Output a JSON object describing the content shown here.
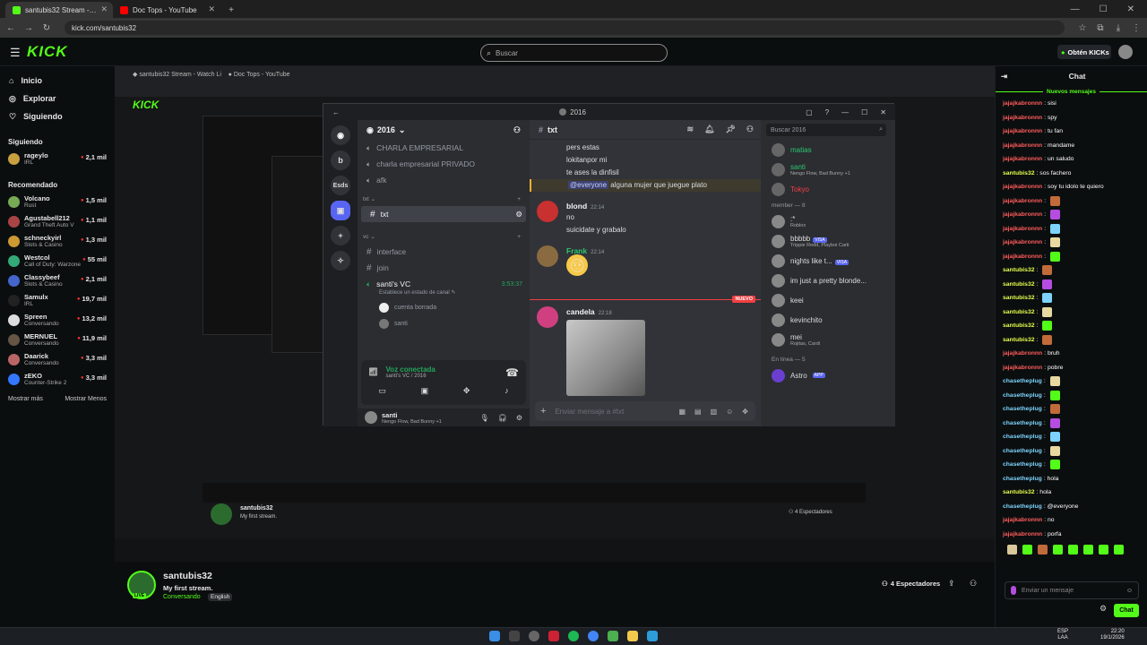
{
  "browser": {
    "tabs": [
      {
        "title": "santubis32 Stream - Watch Live",
        "active": true
      },
      {
        "title": "Doc Tops - YouTube",
        "active": false
      }
    ],
    "url": "kick.com/santubis32"
  },
  "kick": {
    "logo": "KICK",
    "search_placeholder": "Buscar",
    "get_kicks": "Obtén KICKs",
    "nav": [
      {
        "label": "Inicio",
        "icon": "home-icon"
      },
      {
        "label": "Explorar",
        "icon": "compass-icon"
      },
      {
        "label": "Siguiendo",
        "icon": "heart-icon"
      }
    ],
    "following_header": "Siguiendo",
    "following": [
      {
        "name": "rageylo",
        "game": "IRL",
        "viewers": "2,1 mil"
      }
    ],
    "recommended_header": "Recomendado",
    "recommended": [
      {
        "name": "Volcano",
        "game": "Rust",
        "viewers": "1,5 mil"
      },
      {
        "name": "Agustabell212",
        "game": "Grand Theft Auto V",
        "viewers": "1,1 mil"
      },
      {
        "name": "schneckyirl",
        "game": "Slots & Casino",
        "viewers": "1,3 mil"
      },
      {
        "name": "Westcol",
        "game": "Call of Duty: Warzone",
        "viewers": "55 mil"
      },
      {
        "name": "Classybeef",
        "game": "Slots & Casino",
        "viewers": "2,1 mil"
      },
      {
        "name": "Samulx",
        "game": "IRL",
        "viewers": "19,7 mil"
      },
      {
        "name": "Spreen",
        "game": "Conversando",
        "viewers": "13,2 mil"
      },
      {
        "name": "MERNUEL",
        "game": "Conversando",
        "viewers": "11,9 mil"
      },
      {
        "name": "Daarick",
        "game": "Conversando",
        "viewers": "3,3 mil"
      },
      {
        "name": "zEKO",
        "game": "Counter-Strike 2",
        "viewers": "3,3 mil"
      }
    ],
    "show_more": "Mostrar más",
    "show_less": "Mostrar Menos"
  },
  "discord": {
    "window_title": "2016",
    "server_name": "2016",
    "server_icons": [
      "b",
      "Esds"
    ],
    "channels_top": [
      {
        "name": "CHARLA EMPRESARIAL",
        "type": "voice"
      },
      {
        "name": "charla empresarial PRIVADO",
        "type": "voice"
      },
      {
        "name": "afk",
        "type": "voice"
      }
    ],
    "cat_txt": "txt",
    "txt_channel": "txt",
    "cat_vc": "vc",
    "vc_channels": [
      {
        "name": "interface",
        "type": "text"
      },
      {
        "name": "join",
        "type": "text"
      }
    ],
    "active_vc": {
      "name": "santi's VC",
      "time": "3:53:37",
      "status": "Establece un estado de canal"
    },
    "vc_users": [
      "cuenta borrada",
      "santi"
    ],
    "voice_connected": "Voz conectada",
    "voice_sub": "santi's VC / 2016",
    "user": {
      "name": "santi",
      "status": "Nengo Flow, Bad Bunny +1"
    },
    "channel_header": "txt",
    "search_placeholder": "Buscar 2016",
    "top_messages": [
      "pers estas",
      "lokitanpor mi",
      "te ases la dinfisil"
    ],
    "everyone_msg": {
      "mention": "@everyone",
      "text": "alguna mujer que juegue plato"
    },
    "messages": [
      {
        "author": "blond",
        "time": "22:14",
        "lines": [
          "no",
          "suicidate y grabalo"
        ]
      },
      {
        "author": "Frank",
        "time": "22:14",
        "lines": []
      },
      {
        "author": "candela",
        "time": "22:18",
        "lines": []
      }
    ],
    "new_label": "NUEVO",
    "input_placeholder": "Enviar mensaje a #txt",
    "members_top": [
      {
        "name": "matias",
        "sub": ""
      },
      {
        "name": "santi",
        "sub": "Nengo Flow, Bad Bunny +1"
      },
      {
        "name": "Tokyo",
        "sub": ""
      }
    ],
    "member_cat": "member — 8",
    "members": [
      {
        "name": ":*",
        "sub": "Roblox"
      },
      {
        "name": "bbbbb",
        "sub": "Trippie Redd, Playboi Carti",
        "badge": "VISA"
      },
      {
        "name": "nights like t...",
        "sub": "",
        "badge": "VISA"
      },
      {
        "name": "im just a pretty blonde...",
        "sub": ""
      },
      {
        "name": "keei",
        "sub": ""
      },
      {
        "name": "kevinchito",
        "sub": ""
      },
      {
        "name": "mei",
        "sub": "Rojitas, Cardi"
      }
    ],
    "online_cat": "En línea — 5",
    "online_members": [
      {
        "name": "Astro",
        "badge": "APP"
      }
    ]
  },
  "stream": {
    "streamer": "santubis32",
    "title": "My first stream.",
    "category": "Conversando",
    "language": "English",
    "live_label": "LIVE",
    "viewers": "4 Espectadores"
  },
  "chat": {
    "title": "Chat",
    "new_messages": "Nuevos mensajes",
    "messages": [
      {
        "user": "jajajkabronnn",
        "text": "sisi",
        "color": "#ff5c5c"
      },
      {
        "user": "jajajkabronnn",
        "text": "spy",
        "color": "#ff5c5c"
      },
      {
        "user": "jajajkabronnn",
        "text": "tu fan",
        "color": "#ff5c5c"
      },
      {
        "user": "jajajkabronnn",
        "text": "mandame",
        "color": "#ff5c5c"
      },
      {
        "user": "jajajkabronnn",
        "text": "un saludo",
        "color": "#ff5c5c"
      },
      {
        "user": "santubis32",
        "text": "sos fachero",
        "color": "#e4ff4c"
      },
      {
        "user": "jajajkabronnn",
        "text": "soy tu idolo te quiero",
        "color": "#ff5c5c"
      },
      {
        "user": "jajajkabronnn",
        "text": "",
        "color": "#ff5c5c"
      },
      {
        "user": "jajajkabronnn",
        "text": "",
        "color": "#ff5c5c"
      },
      {
        "user": "jajajkabronnn",
        "text": "",
        "color": "#ff5c5c"
      },
      {
        "user": "jajajkabronnn",
        "text": "",
        "color": "#ff5c5c"
      },
      {
        "user": "jajajkabronnn",
        "text": "",
        "color": "#ff5c5c"
      },
      {
        "user": "santubis32",
        "text": "",
        "color": "#e4ff4c"
      },
      {
        "user": "santubis32",
        "text": "",
        "color": "#e4ff4c"
      },
      {
        "user": "santubis32",
        "text": "",
        "color": "#e4ff4c"
      },
      {
        "user": "santubis32",
        "text": "",
        "color": "#e4ff4c"
      },
      {
        "user": "santubis32",
        "text": "",
        "color": "#e4ff4c"
      },
      {
        "user": "santubis32",
        "text": "",
        "color": "#e4ff4c"
      },
      {
        "user": "jajajkabronnn",
        "text": "bruh",
        "color": "#ff5c5c"
      },
      {
        "user": "jajajkabronnn",
        "text": "pobre",
        "color": "#ff5c5c"
      },
      {
        "user": "chasetheplug",
        "text": "",
        "color": "#7dd3fc"
      },
      {
        "user": "chasetheplug",
        "text": "",
        "color": "#7dd3fc"
      },
      {
        "user": "chasetheplug",
        "text": "",
        "color": "#7dd3fc"
      },
      {
        "user": "chasetheplug",
        "text": "",
        "color": "#7dd3fc"
      },
      {
        "user": "chasetheplug",
        "text": "",
        "color": "#7dd3fc"
      },
      {
        "user": "chasetheplug",
        "text": "",
        "color": "#7dd3fc"
      },
      {
        "user": "chasetheplug",
        "text": "",
        "color": "#7dd3fc"
      },
      {
        "user": "chasetheplug",
        "text": "hola",
        "color": "#7dd3fc"
      },
      {
        "user": "santubis32",
        "text": "hola",
        "color": "#e4ff4c"
      },
      {
        "user": "chasetheplug",
        "text": "@everyone",
        "color": "#7dd3fc"
      },
      {
        "user": "jajajkabronnn",
        "text": "no",
        "color": "#ff5c5c"
      },
      {
        "user": "jajajkabronnn",
        "text": "porfa",
        "color": "#ff5c5c"
      }
    ],
    "input_placeholder": "Enviar un mensaje",
    "send_label": "Chat"
  },
  "taskbar": {
    "lang": "ESP",
    "lang2": "LAA",
    "time": "22:20",
    "date": "19/1/2026"
  },
  "colors": {
    "accent": "#53fc18",
    "live": "#ff3b3b",
    "discord_bg": "#313338"
  }
}
